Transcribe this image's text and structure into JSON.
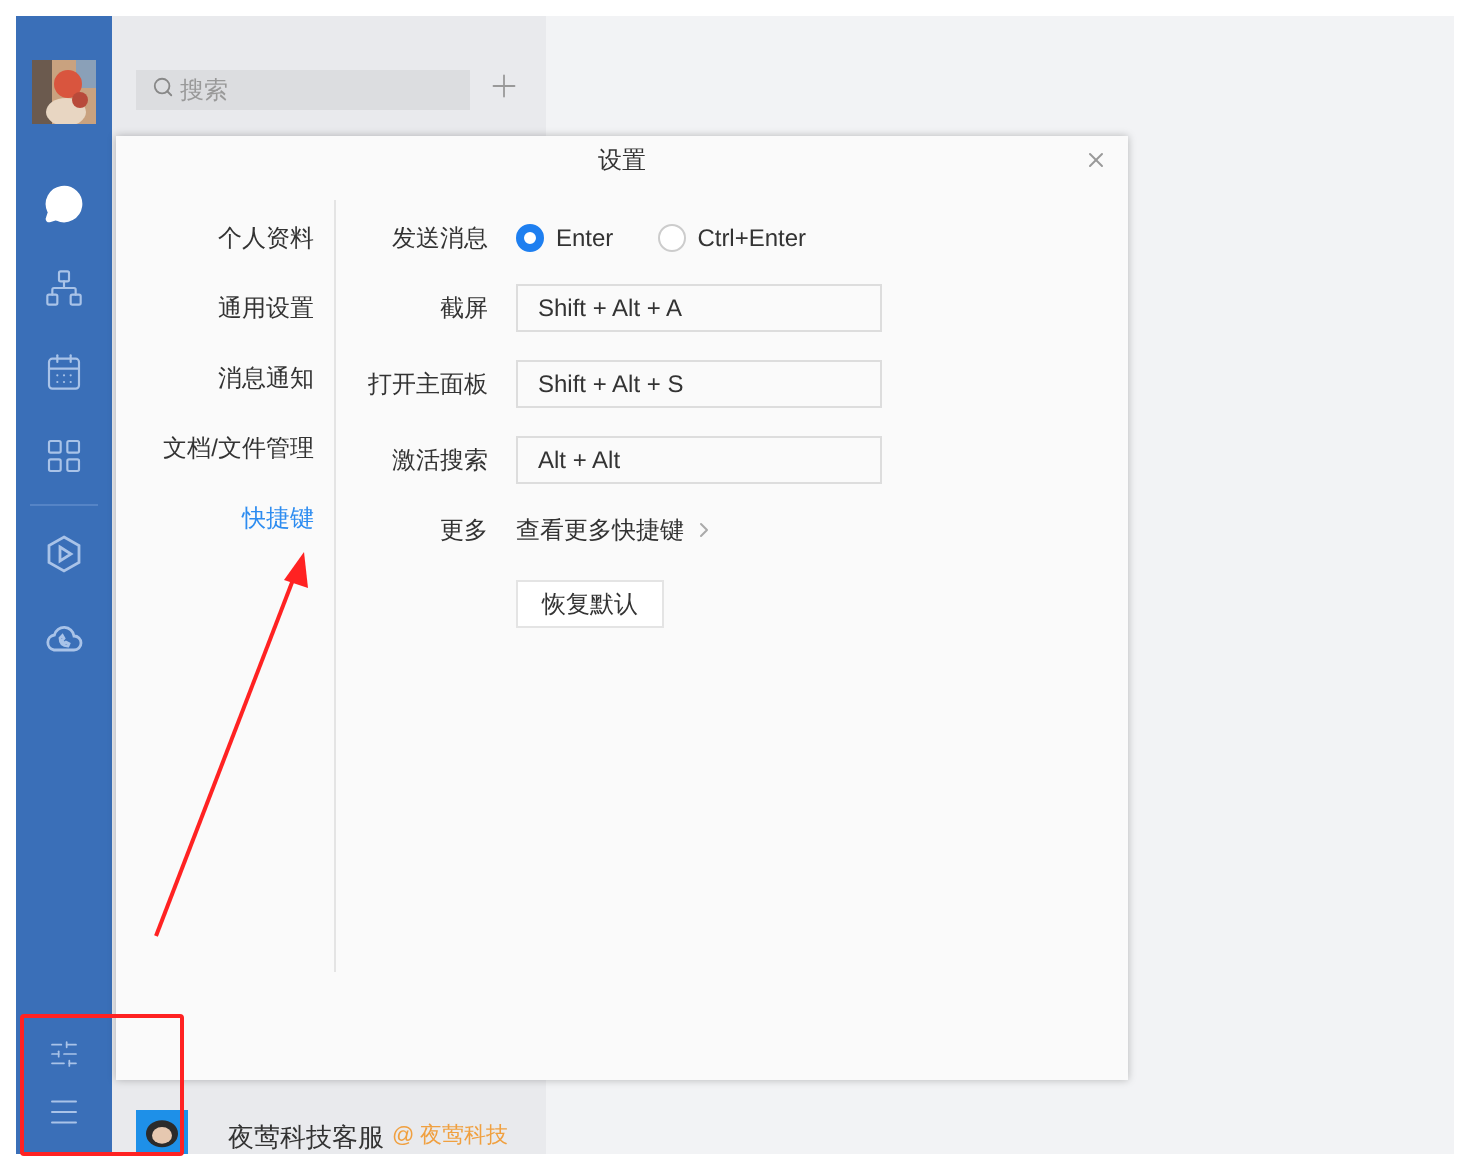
{
  "sidebar": {
    "nav": [
      {
        "kind": "chat",
        "selected": true
      },
      {
        "kind": "org",
        "selected": false
      },
      {
        "kind": "calendar",
        "selected": false
      },
      {
        "kind": "apps",
        "selected": false
      },
      {
        "kind": "video",
        "selected": false
      },
      {
        "kind": "cloud",
        "selected": false
      }
    ],
    "bottom": [
      {
        "kind": "settings"
      },
      {
        "kind": "menu"
      }
    ]
  },
  "chat_list": {
    "search": {
      "placeholder": "搜索"
    },
    "items": [
      {
        "name": "夜莺科技客服",
        "tag": "@ 夜莺科技"
      }
    ]
  },
  "dialog": {
    "title": "设置",
    "nav": [
      {
        "label": "个人资料",
        "selected": false
      },
      {
        "label": "通用设置",
        "selected": false
      },
      {
        "label": "消息通知",
        "selected": false
      },
      {
        "label": "文档/文件管理",
        "selected": false
      },
      {
        "label": "快捷键",
        "selected": true
      }
    ],
    "send_message": {
      "label": "发送消息",
      "options": [
        {
          "label": "Enter",
          "selected": true
        },
        {
          "label": "Ctrl+Enter",
          "selected": false
        }
      ]
    },
    "shortcuts": [
      {
        "label": "截屏",
        "value": "Shift + Alt + A"
      },
      {
        "label": "打开主面板",
        "value": "Shift + Alt + S"
      },
      {
        "label": "激活搜索",
        "value": "Alt + Alt"
      }
    ],
    "more": {
      "label": "更多",
      "link": "查看更多快捷键"
    },
    "reset_button": "恢复默认"
  }
}
